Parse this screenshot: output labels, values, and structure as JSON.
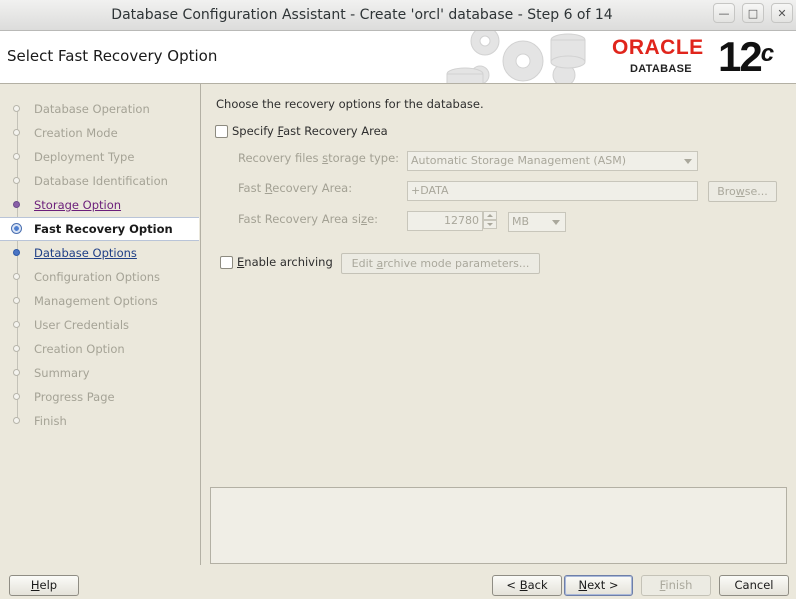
{
  "window": {
    "title": "Database Configuration Assistant - Create 'orcl' database - Step 6 of 14"
  },
  "header": {
    "title": "Select Fast Recovery Option",
    "logo_text": "ORACLE",
    "logo_sub": "DATABASE",
    "version_num": "12",
    "version_suffix": "c",
    "brand_color": "#e0251c"
  },
  "nav": {
    "steps": [
      {
        "label": "Database Operation",
        "state": "pending"
      },
      {
        "label": "Creation Mode",
        "state": "pending"
      },
      {
        "label": "Deployment Type",
        "state": "pending"
      },
      {
        "label": "Database Identification",
        "state": "pending"
      },
      {
        "label": "Storage Option",
        "state": "visited"
      },
      {
        "label": "Fast Recovery Option",
        "state": "current"
      },
      {
        "label": "Database Options",
        "state": "next"
      },
      {
        "label": "Configuration Options",
        "state": "pending"
      },
      {
        "label": "Management Options",
        "state": "pending"
      },
      {
        "label": "User Credentials",
        "state": "pending"
      },
      {
        "label": "Creation Option",
        "state": "pending"
      },
      {
        "label": "Summary",
        "state": "pending"
      },
      {
        "label": "Progress Page",
        "state": "pending"
      },
      {
        "label": "Finish",
        "state": "pending"
      }
    ]
  },
  "content": {
    "intro": "Choose the recovery options for the database.",
    "specify_fra": {
      "label_pre": "Specify ",
      "label_key": "F",
      "label_post": "ast Recovery Area",
      "checked": false
    },
    "storage_type": {
      "label_pre": "Recovery files ",
      "label_key": "s",
      "label_post": "torage type:",
      "value": "Automatic Storage Management (ASM)"
    },
    "fra_location": {
      "label_pre": "Fast ",
      "label_key": "R",
      "label_post": "ecovery Area:",
      "value": "+DATA",
      "browse_pre": "Bro",
      "browse_key": "w",
      "browse_post": "se..."
    },
    "fra_size": {
      "label_pre": "Fast Recovery Area si",
      "label_key": "z",
      "label_post": "e:",
      "value": "12780",
      "unit": "MB"
    },
    "archiving": {
      "label_pre": "",
      "label_key": "E",
      "label_post": "nable archiving",
      "checked": false,
      "edit_pre": "Edit ",
      "edit_key": "a",
      "edit_post": "rchive mode parameters..."
    }
  },
  "buttons": {
    "help_key": "H",
    "help_rest": "elp",
    "back_pre": "< ",
    "back_key": "B",
    "back_post": "ack",
    "next_key": "N",
    "next_post": "ext >",
    "finish_key": "F",
    "finish_post": "inish",
    "cancel": "Cancel"
  }
}
